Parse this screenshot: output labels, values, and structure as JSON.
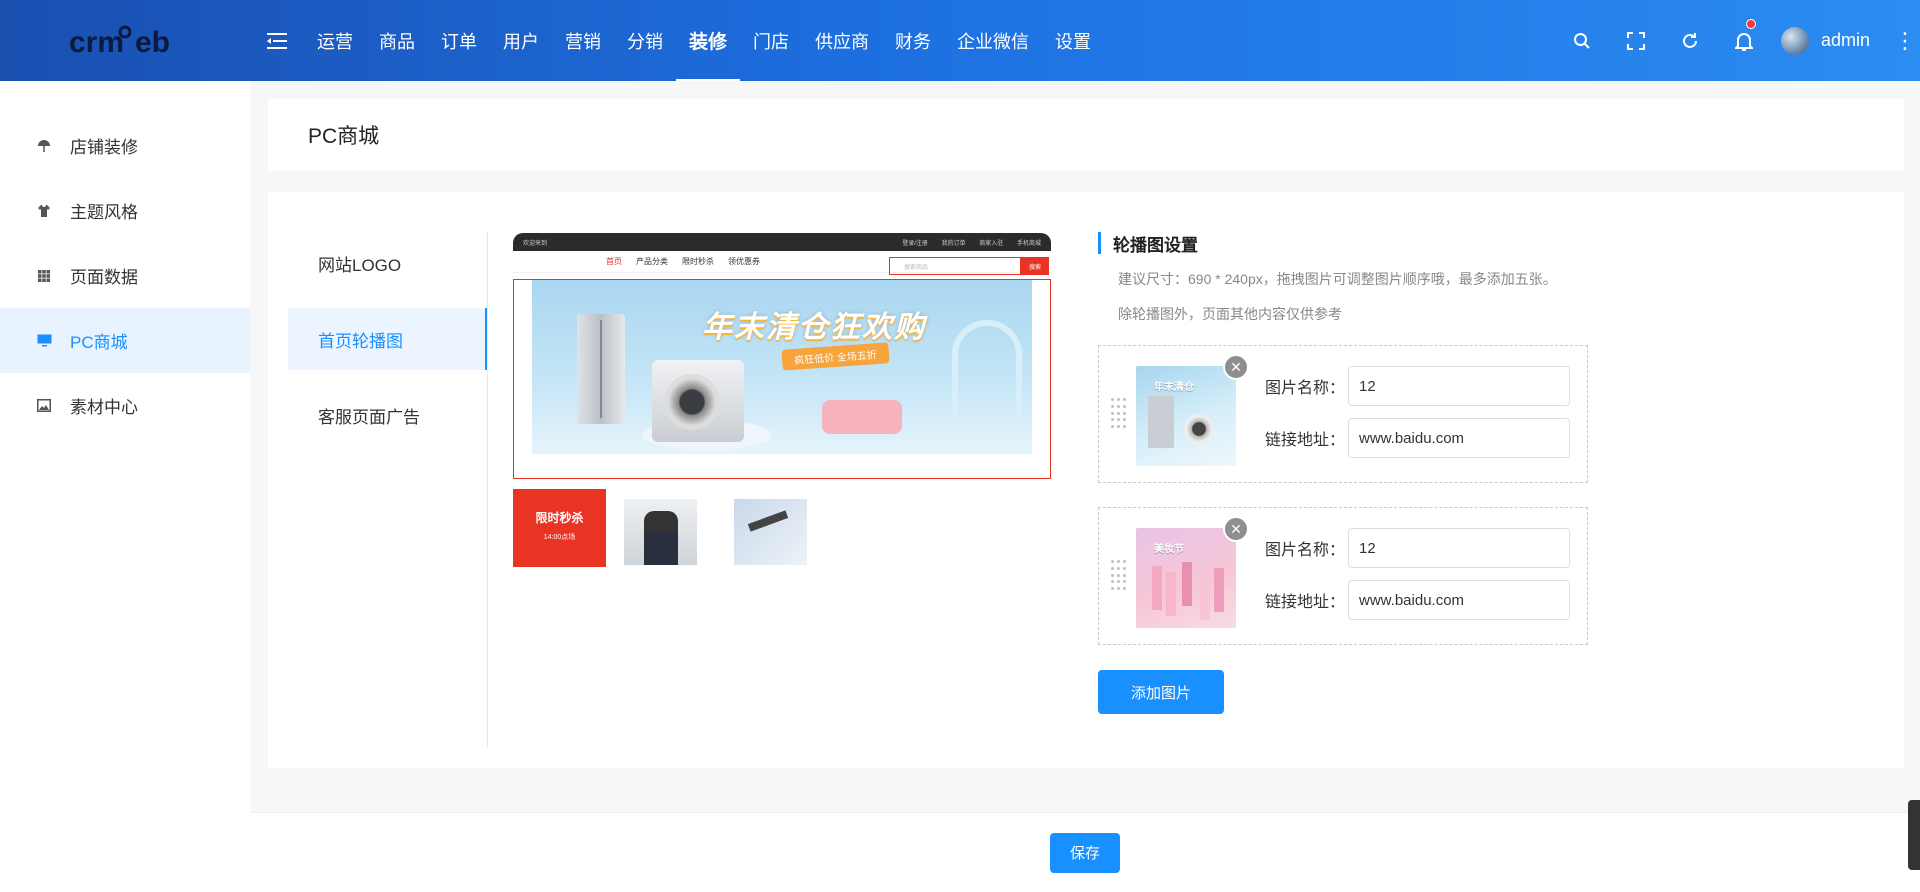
{
  "header": {
    "brand": "crmeb",
    "nav": [
      "运营",
      "商品",
      "订单",
      "用户",
      "营销",
      "分销",
      "装修",
      "门店",
      "供应商",
      "财务",
      "企业微信",
      "设置"
    ],
    "active_nav": "装修",
    "username": "admin",
    "tool_icons": [
      "search-icon",
      "fullscreen-icon",
      "refresh-icon",
      "bell-icon"
    ]
  },
  "sidebar": {
    "items": [
      {
        "label": "店铺装修",
        "icon": "umbrella-icon"
      },
      {
        "label": "主题风格",
        "icon": "shirt-icon"
      },
      {
        "label": "页面数据",
        "icon": "grid-icon"
      },
      {
        "label": "PC商城",
        "icon": "monitor-icon",
        "active": true
      },
      {
        "label": "素材中心",
        "icon": "image-icon"
      }
    ]
  },
  "page": {
    "title": "PC商城"
  },
  "subnav": {
    "items": [
      "网站LOGO",
      "首页轮播图",
      "客服页面广告"
    ],
    "active": "首页轮播图"
  },
  "preview": {
    "top_left": "欢迎来到",
    "top_links": [
      "登录/注册",
      "我的订单",
      "商家入驻",
      "手机商城"
    ],
    "menu": [
      "首页",
      "产品分类",
      "限时秒杀",
      "领优惠券"
    ],
    "search_placeholder": "搜索商品",
    "search_button": "搜索",
    "banner_headline": "年末清仓狂欢购",
    "banner_ribbon": "疯狂低价 全场五折",
    "flash_title": "限时秒杀",
    "flash_time": "14:00点场"
  },
  "settings": {
    "title": "轮播图设置",
    "tip1": "建议尺寸：690 * 240px，拖拽图片可调整图片顺序哦，最多添加五张。",
    "tip2": "除轮播图外，页面其他内容仅供参考",
    "name_label": "图片名称：",
    "link_label": "链接地址：",
    "items": [
      {
        "name": "12",
        "link": "www.baidu.com",
        "thumb_text": "年末清仓"
      },
      {
        "name": "12",
        "link": "www.baidu.com",
        "thumb_text": "美妆节"
      }
    ],
    "add_button": "添加图片"
  },
  "footer": {
    "save_button": "保存"
  },
  "colors": {
    "primary": "#1890ff",
    "header_start": "#1a4fb0",
    "header_end": "#2b8cf2",
    "accent_red": "#e93323"
  }
}
